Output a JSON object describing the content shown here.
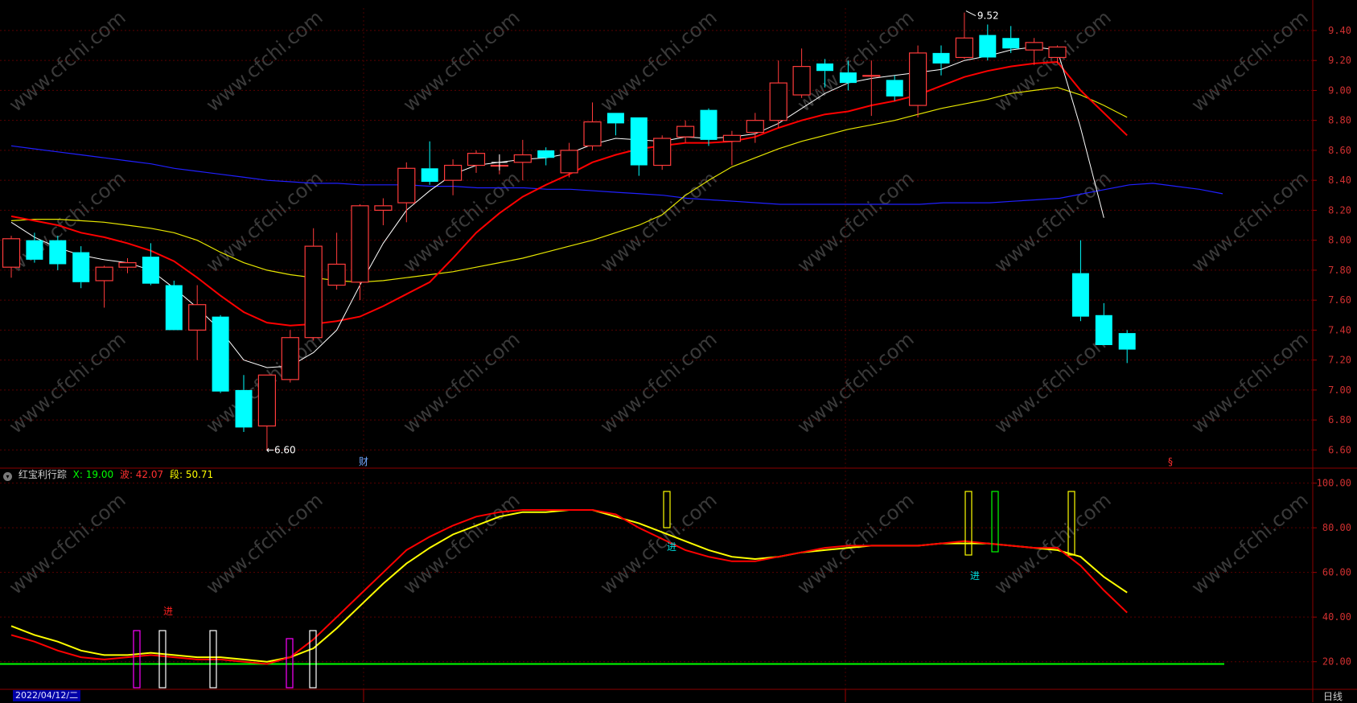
{
  "colors": {
    "background": "#000000",
    "grid": "#5a0000",
    "up": "#ff3b3b",
    "down": "#00ffff",
    "ma_white": "#ffffff",
    "ma_red": "#ff0000",
    "ma_yellow": "#e6e600",
    "ma_blue": "#2020ff",
    "ind_red": "#ff0000",
    "ind_yellow": "#ffff00",
    "ind_green": "#00ff00",
    "watermark": "#3a3a3a"
  },
  "watermark_text": "www.cfchi.com",
  "indicator": {
    "icon": "chevron-down-icon",
    "name": "红宝利行踪",
    "x_label": "X: 19.00",
    "bo_label": "波: 42.07",
    "duan_label": "段: 50.71"
  },
  "date_badge": "2022/04/12/二",
  "period_tab": "日线",
  "chart_data": [
    {
      "type": "candlestick",
      "ylim": [
        6.5,
        9.55
      ],
      "y_ticks": [
        "6.60",
        "6.80",
        "7.00",
        "7.20",
        "7.40",
        "7.60",
        "7.80",
        "8.00",
        "8.20",
        "8.40",
        "8.60",
        "8.80",
        "9.00",
        "9.20",
        "9.40"
      ],
      "candles": [
        {
          "o": 7.82,
          "c": 8.01,
          "h": 8.03,
          "l": 7.75
        },
        {
          "o": 8.0,
          "c": 7.87,
          "h": 8.05,
          "l": 7.85
        },
        {
          "o": 8.0,
          "c": 7.84,
          "h": 8.03,
          "l": 7.8
        },
        {
          "o": 7.92,
          "c": 7.72,
          "h": 7.96,
          "l": 7.68
        },
        {
          "o": 7.73,
          "c": 7.82,
          "h": 7.83,
          "l": 7.55
        },
        {
          "o": 7.82,
          "c": 7.85,
          "h": 7.88,
          "l": 7.78
        },
        {
          "o": 7.89,
          "c": 7.71,
          "h": 7.98,
          "l": 7.7
        },
        {
          "o": 7.7,
          "c": 7.4,
          "h": 7.73,
          "l": 7.4
        },
        {
          "o": 7.4,
          "c": 7.57,
          "h": 7.7,
          "l": 7.2
        },
        {
          "o": 7.49,
          "c": 6.99,
          "h": 7.5,
          "l": 6.98
        },
        {
          "o": 7.0,
          "c": 6.75,
          "h": 7.1,
          "l": 6.72
        },
        {
          "o": 6.76,
          "c": 7.1,
          "h": 7.1,
          "l": 6.6
        },
        {
          "o": 7.07,
          "c": 7.35,
          "h": 7.4,
          "l": 7.05
        },
        {
          "o": 7.35,
          "c": 7.96,
          "h": 8.08,
          "l": 7.33
        },
        {
          "o": 7.7,
          "c": 7.84,
          "h": 8.05,
          "l": 7.67
        },
        {
          "o": 7.72,
          "c": 8.23,
          "h": 8.24,
          "l": 7.6
        },
        {
          "o": 8.2,
          "c": 8.23,
          "h": 8.28,
          "l": 8.1
        },
        {
          "o": 8.25,
          "c": 8.48,
          "h": 8.52,
          "l": 8.12
        },
        {
          "o": 8.48,
          "c": 8.39,
          "h": 8.66,
          "l": 8.37
        },
        {
          "o": 8.4,
          "c": 8.5,
          "h": 8.54,
          "l": 8.3
        },
        {
          "o": 8.5,
          "c": 8.58,
          "h": 8.6,
          "l": 8.45
        },
        {
          "o": 8.5,
          "c": 8.5,
          "h": 8.56,
          "l": 8.44
        },
        {
          "o": 8.52,
          "c": 8.57,
          "h": 8.67,
          "l": 8.4
        },
        {
          "o": 8.6,
          "c": 8.55,
          "h": 8.62,
          "l": 8.5
        },
        {
          "o": 8.45,
          "c": 8.6,
          "h": 8.65,
          "l": 8.42
        },
        {
          "o": 8.63,
          "c": 8.79,
          "h": 8.92,
          "l": 8.6
        },
        {
          "o": 8.85,
          "c": 8.78,
          "h": 8.85,
          "l": 8.7
        },
        {
          "o": 8.82,
          "c": 8.5,
          "h": 8.82,
          "l": 8.43
        },
        {
          "o": 8.5,
          "c": 8.68,
          "h": 8.7,
          "l": 8.47
        },
        {
          "o": 8.69,
          "c": 8.76,
          "h": 8.8,
          "l": 8.65
        },
        {
          "o": 8.87,
          "c": 8.67,
          "h": 8.88,
          "l": 8.63
        },
        {
          "o": 8.66,
          "c": 8.7,
          "h": 8.73,
          "l": 8.5
        },
        {
          "o": 8.72,
          "c": 8.8,
          "h": 8.85,
          "l": 8.65
        },
        {
          "o": 8.8,
          "c": 9.05,
          "h": 9.2,
          "l": 8.75
        },
        {
          "o": 8.97,
          "c": 9.16,
          "h": 9.28,
          "l": 8.95
        },
        {
          "o": 9.18,
          "c": 9.13,
          "h": 9.21,
          "l": 9.02
        },
        {
          "o": 9.12,
          "c": 9.05,
          "h": 9.2,
          "l": 9.0
        },
        {
          "o": 9.1,
          "c": 9.1,
          "h": 9.2,
          "l": 8.83
        },
        {
          "o": 9.07,
          "c": 8.96,
          "h": 9.1,
          "l": 8.93
        },
        {
          "o": 8.9,
          "c": 9.25,
          "h": 9.3,
          "l": 8.82
        },
        {
          "o": 9.25,
          "c": 9.18,
          "h": 9.3,
          "l": 9.1
        },
        {
          "o": 9.22,
          "c": 9.35,
          "h": 9.52,
          "l": 9.21
        },
        {
          "o": 9.37,
          "c": 9.22,
          "h": 9.44,
          "l": 9.2
        },
        {
          "o": 9.35,
          "c": 9.28,
          "h": 9.43,
          "l": 9.25
        },
        {
          "o": 9.27,
          "c": 9.32,
          "h": 9.35,
          "l": 9.17
        },
        {
          "o": 9.22,
          "c": 9.29,
          "h": 9.3,
          "l": 9.18
        },
        {
          "o": 7.78,
          "c": 7.49,
          "h": 8.0,
          "l": 7.46
        },
        {
          "o": 7.5,
          "c": 7.3,
          "h": 7.58,
          "l": 7.3
        },
        {
          "o": 7.38,
          "c": 7.27,
          "h": 7.4,
          "l": 7.18
        }
      ],
      "ma_white": [
        8.12,
        8.02,
        7.95,
        7.9,
        7.87,
        7.85,
        7.8,
        7.68,
        7.55,
        7.4,
        7.2,
        7.15,
        7.16,
        7.25,
        7.4,
        7.7,
        7.98,
        8.2,
        8.33,
        8.44,
        8.5,
        8.52,
        8.54,
        8.55,
        8.58,
        8.64,
        8.68,
        8.67,
        8.66,
        8.69,
        8.68,
        8.69,
        8.71,
        8.78,
        8.88,
        8.98,
        9.05,
        9.08,
        9.1,
        9.12,
        9.14,
        9.2,
        9.23,
        9.27,
        9.29,
        9.27,
        8.75,
        8.15
      ],
      "ma_red": [
        8.16,
        8.13,
        8.1,
        8.05,
        8.02,
        7.98,
        7.93,
        7.86,
        7.75,
        7.63,
        7.52,
        7.45,
        7.43,
        7.44,
        7.46,
        7.49,
        7.56,
        7.64,
        7.72,
        7.88,
        8.05,
        8.18,
        8.29,
        8.37,
        8.44,
        8.52,
        8.57,
        8.61,
        8.63,
        8.65,
        8.65,
        8.66,
        8.69,
        8.75,
        8.8,
        8.84,
        8.86,
        8.9,
        8.93,
        8.97,
        9.03,
        9.09,
        9.13,
        9.16,
        9.18,
        9.19,
        9.0,
        8.85,
        8.7
      ],
      "ma_yellow": [
        8.13,
        8.14,
        8.14,
        8.13,
        8.12,
        8.1,
        8.08,
        8.05,
        8.0,
        7.92,
        7.85,
        7.8,
        7.77,
        7.75,
        7.73,
        7.72,
        7.73,
        7.75,
        7.77,
        7.79,
        7.82,
        7.85,
        7.88,
        7.92,
        7.96,
        8.0,
        8.05,
        8.1,
        8.17,
        8.3,
        8.4,
        8.49,
        8.55,
        8.61,
        8.66,
        8.7,
        8.74,
        8.77,
        8.8,
        8.84,
        8.88,
        8.91,
        8.94,
        8.98,
        9.0,
        9.02,
        8.97,
        8.9,
        8.82
      ],
      "ma_blue": [
        8.63,
        8.61,
        8.59,
        8.57,
        8.55,
        8.53,
        8.51,
        8.48,
        8.46,
        8.44,
        8.42,
        8.4,
        8.39,
        8.38,
        8.38,
        8.37,
        8.37,
        8.37,
        8.36,
        8.36,
        8.35,
        8.35,
        8.35,
        8.34,
        8.34,
        8.33,
        8.32,
        8.31,
        8.3,
        8.28,
        8.27,
        8.26,
        8.25,
        8.24,
        8.24,
        8.24,
        8.24,
        8.24,
        8.24,
        8.24,
        8.25,
        8.25,
        8.25,
        8.26,
        8.27,
        8.28,
        8.31,
        8.34,
        8.37,
        8.38,
        8.36,
        8.34,
        8.31
      ],
      "annotations": [
        {
          "text": "9.52",
          "kind": "high"
        },
        {
          "text": "←6.60",
          "kind": "low"
        },
        {
          "text": "财",
          "kind": "event"
        },
        {
          "text": "§",
          "kind": "event"
        }
      ]
    },
    {
      "type": "line",
      "ylim": [
        8,
        106
      ],
      "y_ticks": [
        "20.00",
        "40.00",
        "60.00",
        "80.00",
        "100.00"
      ],
      "series": [
        {
          "color": "red",
          "values": [
            32,
            29,
            25,
            22,
            21,
            22,
            23,
            22,
            21,
            21,
            20,
            19,
            22,
            30,
            40,
            50,
            60,
            70,
            76,
            81,
            85,
            87,
            88,
            88,
            88,
            88,
            86,
            80,
            75,
            70,
            67,
            65,
            65,
            67,
            69,
            71,
            72,
            72,
            72,
            72,
            73,
            74,
            73,
            72,
            71,
            71,
            63,
            52,
            42
          ]
        },
        {
          "color": "yellow",
          "values": [
            36,
            32,
            29,
            25,
            23,
            23,
            24,
            23,
            22,
            22,
            21,
            20,
            22,
            26,
            35,
            45,
            55,
            64,
            71,
            77,
            81,
            85,
            87,
            87,
            88,
            88,
            85,
            82,
            78,
            74,
            70,
            67,
            66,
            67,
            69,
            70,
            71,
            72,
            72,
            72,
            73,
            73,
            73,
            72,
            71,
            70,
            67,
            58,
            51
          ]
        },
        {
          "color": "green",
          "values": [
            19,
            19
          ]
        }
      ],
      "signals": [
        {
          "text": "进",
          "color": "red"
        },
        {
          "text": "进",
          "color": "cyan"
        },
        {
          "text": "进",
          "color": "cyan"
        }
      ]
    }
  ]
}
